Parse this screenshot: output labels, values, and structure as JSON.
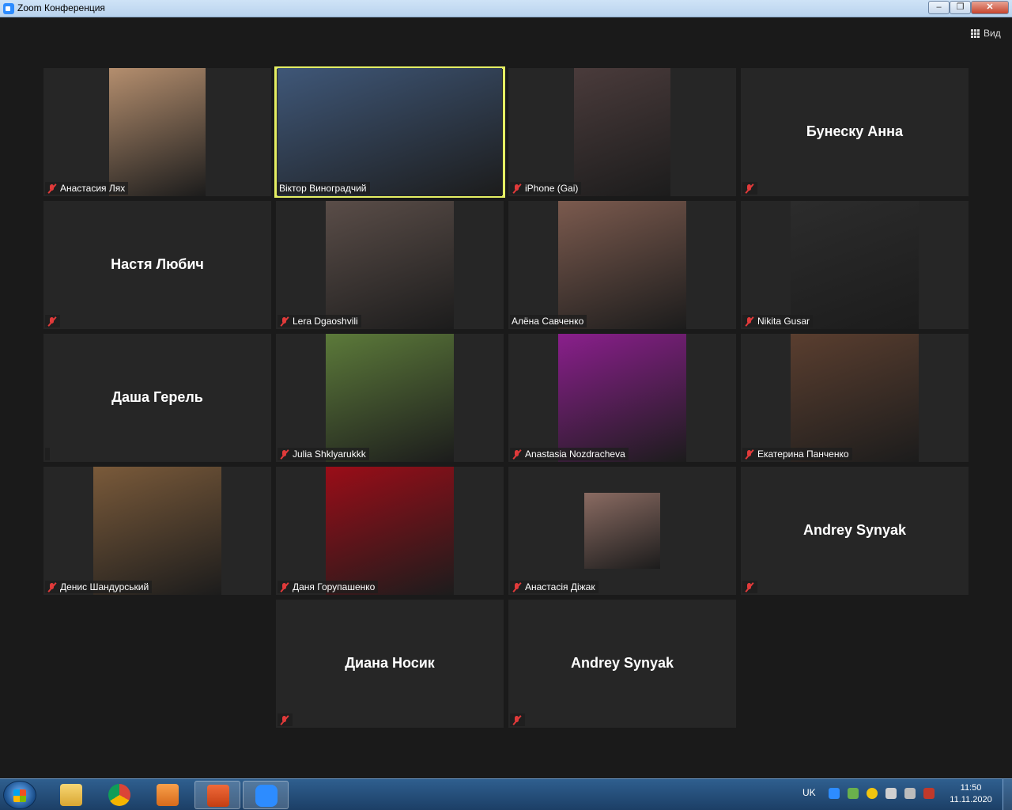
{
  "window": {
    "title": "Zoom Конференция",
    "min": "‒",
    "max": "❐",
    "close": "✕"
  },
  "toolbar": {
    "view_label": "Вид"
  },
  "participants": [
    {
      "name": "Анастасия Лях",
      "muted": true,
      "video": true,
      "bg": "#b48e6e"
    },
    {
      "name": "Віктор Виноградчий",
      "muted": false,
      "video": true,
      "active": true,
      "bg": "#3f5778"
    },
    {
      "name": "iPhone (Gai)",
      "muted": true,
      "video": true,
      "bg": "#4a3b3b"
    },
    {
      "name": "Бунеску Анна",
      "muted": true,
      "video": false
    },
    {
      "name": "Настя Любич",
      "muted": true,
      "video": false
    },
    {
      "name": "Lera Dgaoshvili",
      "muted": true,
      "video": true,
      "bg": "#5a4d48"
    },
    {
      "name": "Алёна Савченко",
      "muted": false,
      "video": true,
      "bg": "#7b5a4e"
    },
    {
      "name": "Nikita Gusar",
      "muted": true,
      "video": true,
      "bg": "#2c2c2c"
    },
    {
      "name": "Даша Герель",
      "muted": false,
      "video": false
    },
    {
      "name": "Julia Shklyarukkk",
      "muted": true,
      "video": true,
      "bg": "#5c7a3a"
    },
    {
      "name": "Anastasia Nozdracheva",
      "muted": true,
      "video": true,
      "bg": "#8a1f8c"
    },
    {
      "name": "Екатерина Панченко",
      "muted": true,
      "video": true,
      "bg": "#5a3e2f"
    },
    {
      "name": "Денис Шандурський",
      "muted": true,
      "video": true,
      "bg": "#7a5a3a"
    },
    {
      "name": "Даня Горупашенко",
      "muted": true,
      "video": true,
      "bg": "#9a0d18"
    },
    {
      "name": "Анастасія Діжак",
      "muted": true,
      "video": true,
      "bg": "#8a6b62"
    },
    {
      "name": "Andrey Synyak",
      "muted": true,
      "video": false
    },
    {
      "name": "Диана Носик",
      "muted": true,
      "video": false
    },
    {
      "name": "Andrey Synyak",
      "muted": true,
      "video": false
    }
  ],
  "tray": {
    "lang": "UK",
    "time": "11:50",
    "date": "11.11.2020"
  }
}
